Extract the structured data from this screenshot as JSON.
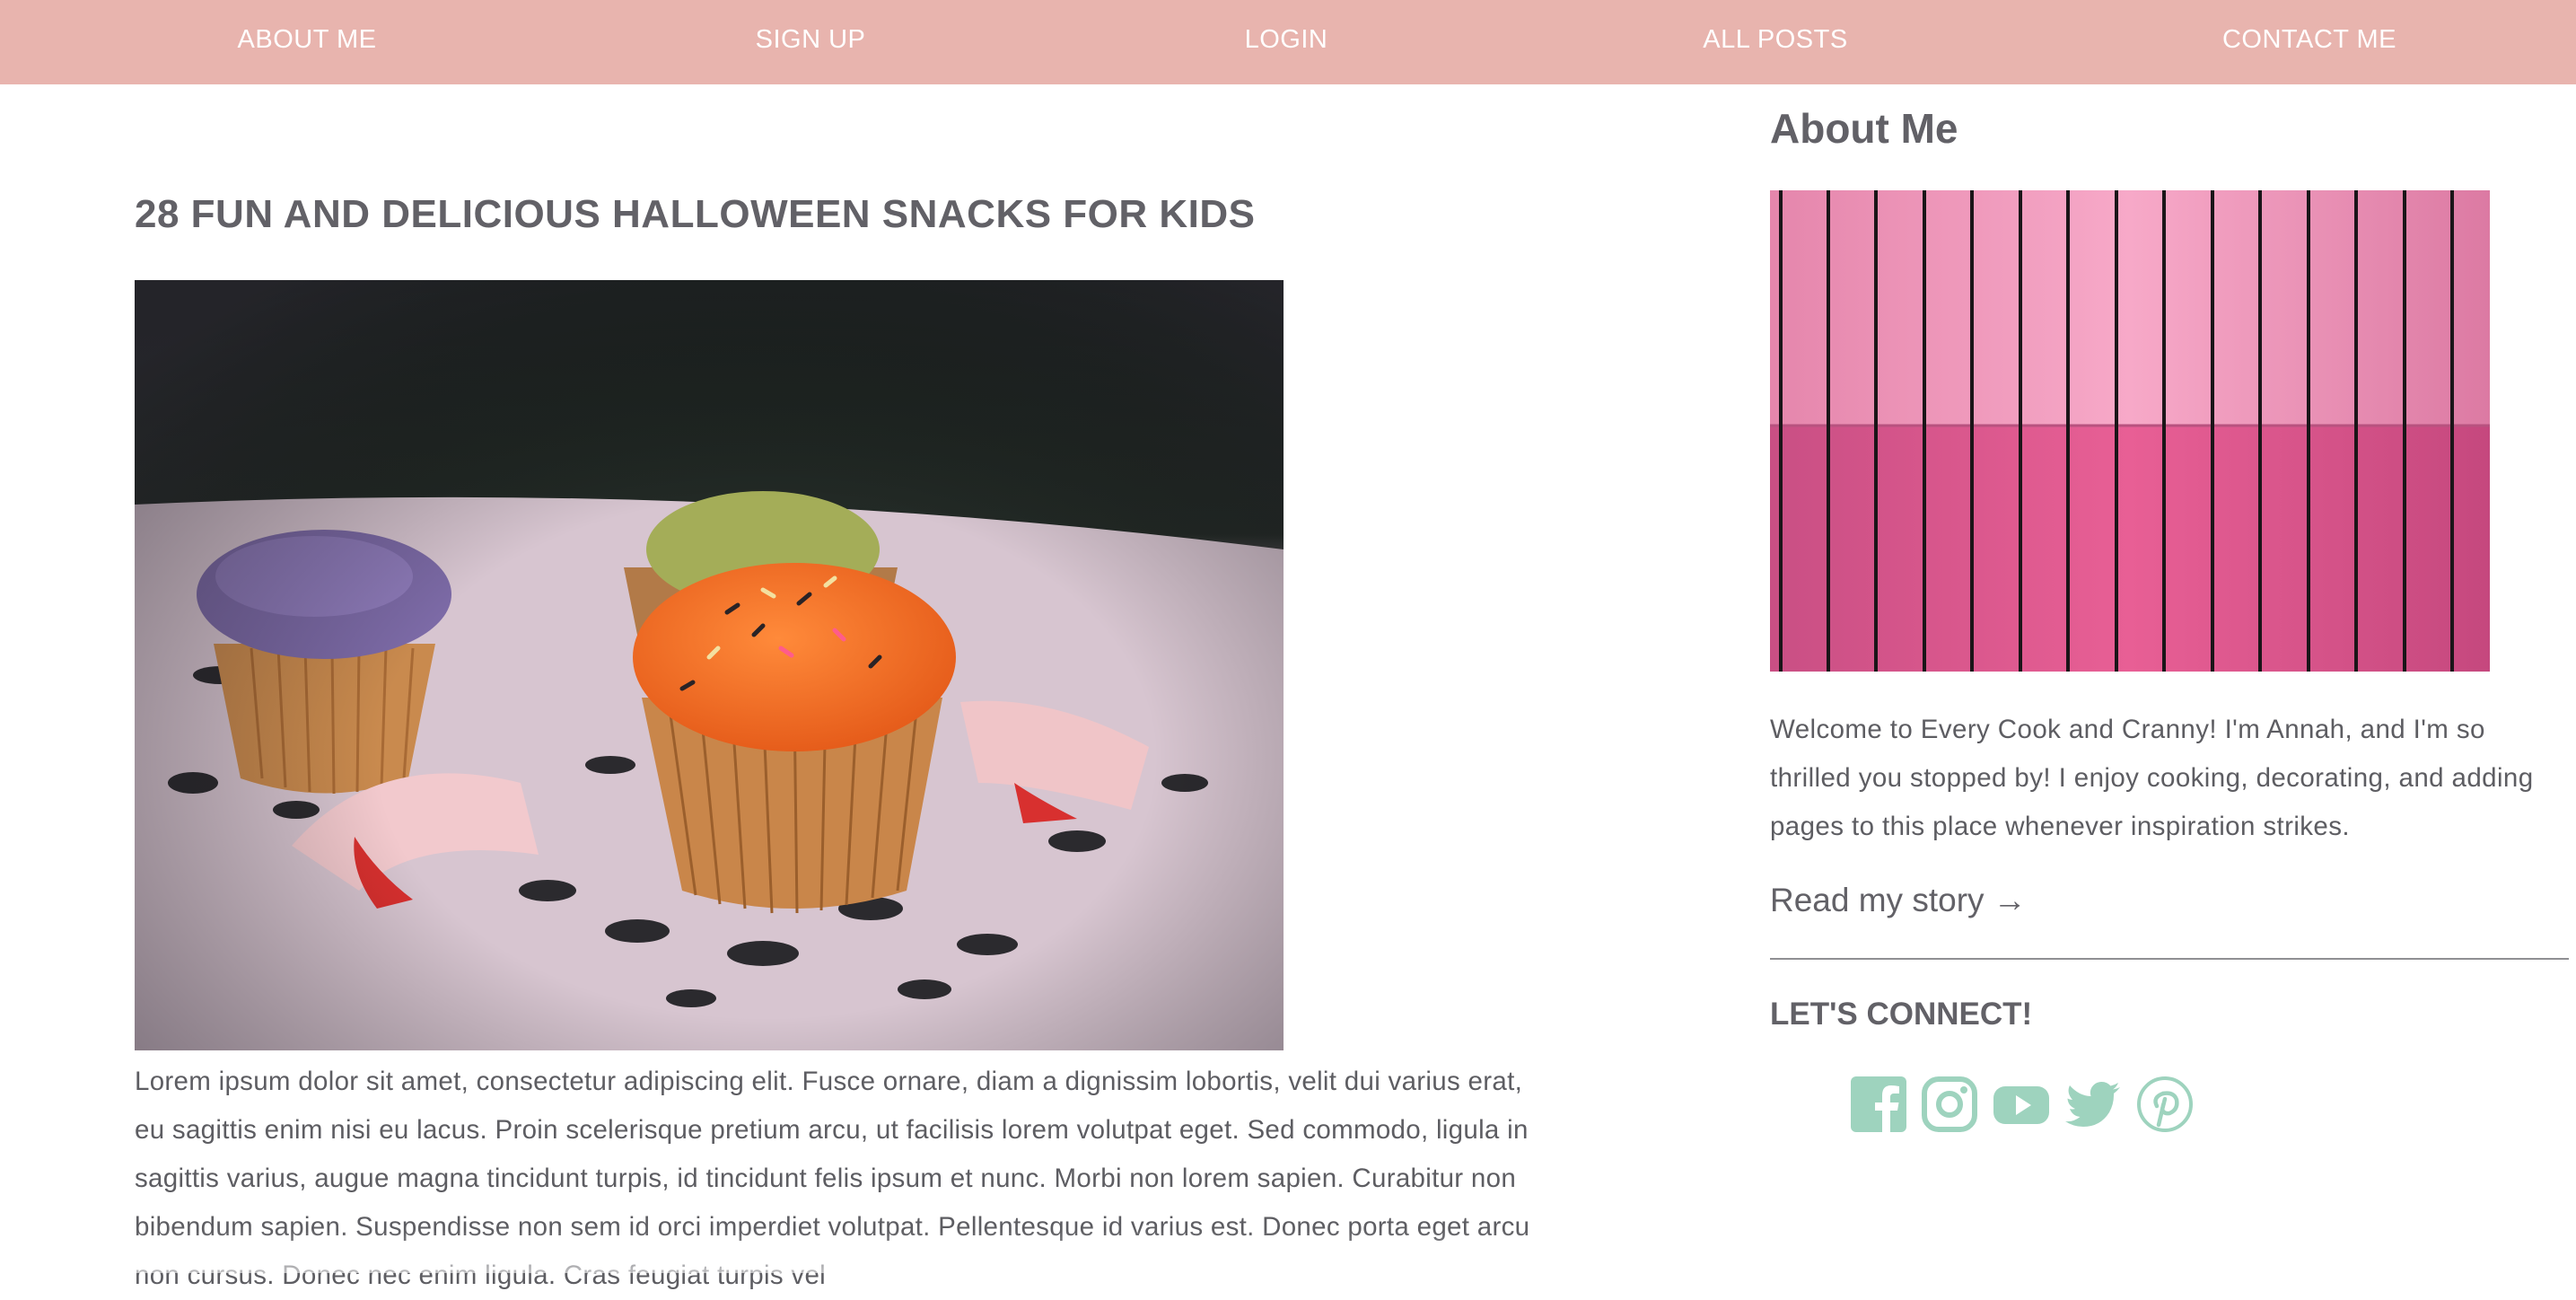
{
  "nav": {
    "items": [
      {
        "label": "ABOUT ME"
      },
      {
        "label": "SIGN UP"
      },
      {
        "label": "LOGIN"
      },
      {
        "label": "ALL POSTS"
      },
      {
        "label": "CONTACT ME"
      }
    ]
  },
  "post": {
    "title": "28 FUN AND DELICIOUS HALLOWEEN SNACKS FOR KIDS",
    "image_icon": "cupcakes-photo",
    "body": "Lorem ipsum dolor sit amet, consectetur adipiscing elit. Fusce ornare, diam a dignissim lobortis, velit dui varius erat, eu sagittis enim nisi eu lacus. Proin scelerisque pretium arcu, ut facilisis lorem volutpat eget. Sed commodo, ligula in sagittis varius, augue magna tincidunt turpis, id tincidunt felis ipsum et nunc. Morbi non lorem sapien. Curabitur non bibendum sapien. Suspendisse non sem id orci imperdiet volutpat. Pellentesque id varius est. Donec porta eget arcu non cursus. Donec nec enim ligula. Cras feugiat turpis vel"
  },
  "sidebar": {
    "title": "About Me",
    "image_icon": "pink-wood-photo",
    "intro": "Welcome to Every Cook and Cranny! I'm Annah, and I'm so thrilled you stopped by! I enjoy cooking, decorating, and adding pages to this place whenever inspiration strikes.",
    "read_story": "Read my story →",
    "connect": "LET'S CONNECT!",
    "social": [
      "facebook-icon",
      "instagram-icon",
      "youtube-icon",
      "twitter-icon",
      "pinterest-icon"
    ]
  },
  "colors": {
    "nav_bg": "#e8b4ae",
    "social_icon": "#9ed3be",
    "text": "#5f5f63"
  }
}
